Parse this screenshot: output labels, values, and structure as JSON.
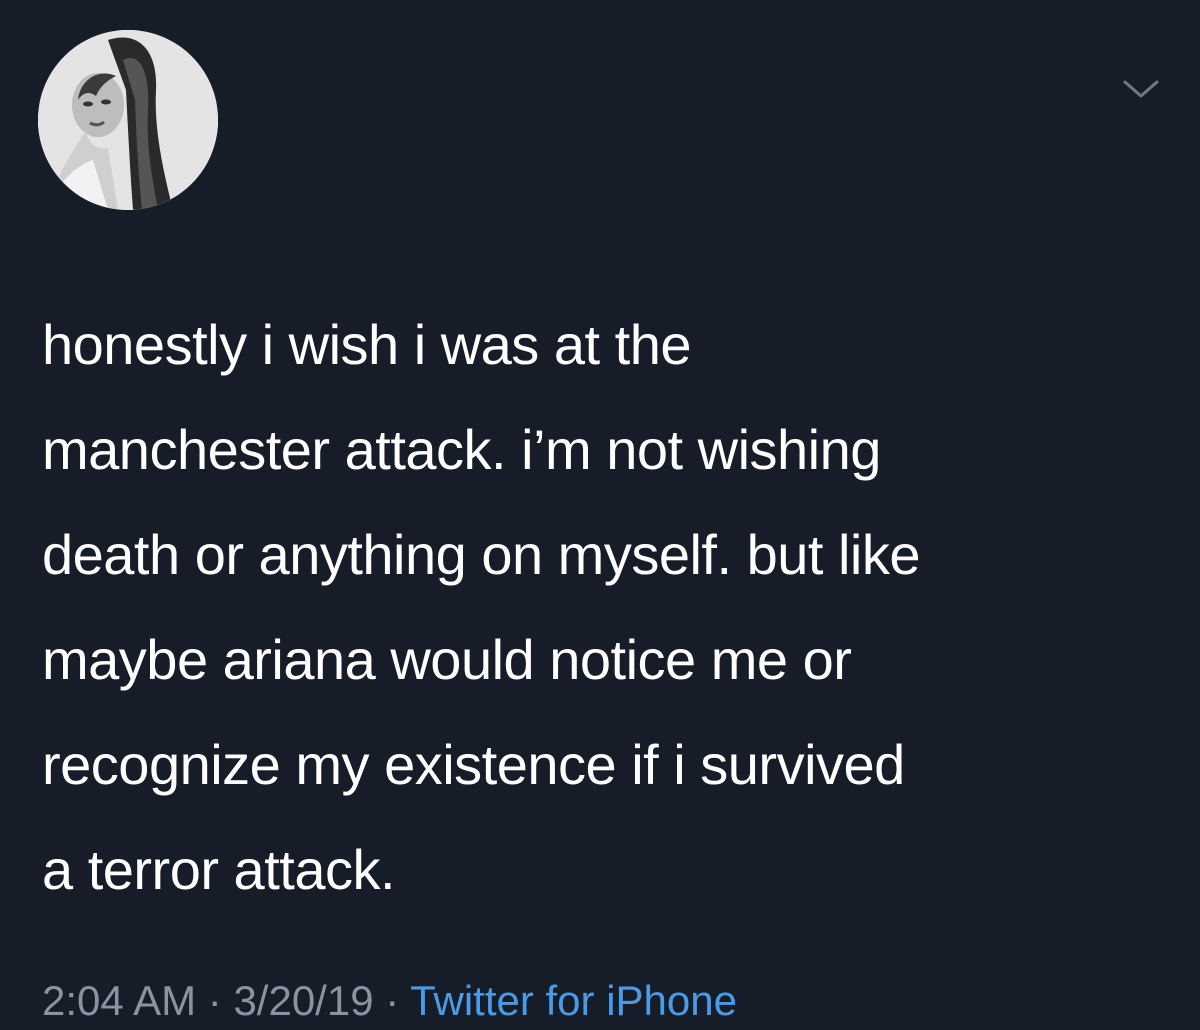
{
  "tweet": {
    "avatar_icon": "profile-photo",
    "caret_icon": "chevron-down-icon",
    "text": "honestly i wish i was at the\nmanchester attack. i’m not wishing\ndeath or anything on myself. but like\nmaybe ariana would notice me or\nrecognize my existence if i survived\na terror attack.",
    "time": "2:04 AM",
    "date": "3/20/19",
    "separator": " · ",
    "source": "Twitter for iPhone"
  },
  "colors": {
    "background": "#161c28",
    "text": "#ffffff",
    "meta": "#8a93a0",
    "link": "#4a9be6"
  }
}
